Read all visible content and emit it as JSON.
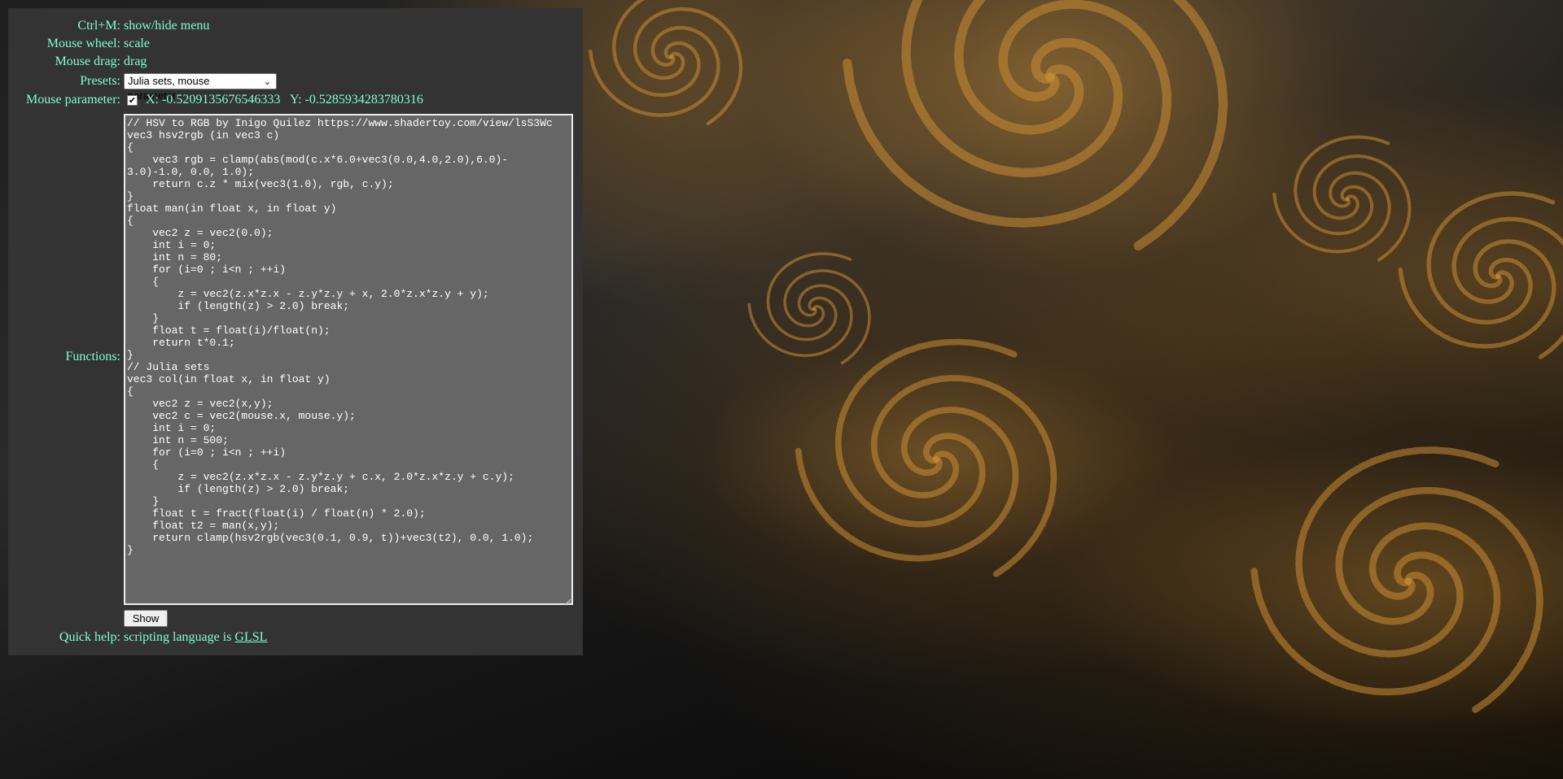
{
  "menu": {
    "rows": [
      {
        "label": "Ctrl+M:",
        "value": "show/hide menu"
      },
      {
        "label": "Mouse wheel:",
        "value": "scale"
      },
      {
        "label": "Mouse drag:",
        "value": "drag"
      }
    ],
    "presets": {
      "label": "Presets:",
      "selected": "Julia sets, mouse parameter"
    },
    "mouse_parameter": {
      "label": "Mouse parameter:",
      "checked": true,
      "x_text": "X: -0.5209135676546333",
      "y_text": "Y: -0.5285934283780316"
    },
    "functions": {
      "label": "Functions:",
      "code": "// HSV to RGB by Inigo Quilez https://www.shadertoy.com/view/lsS3Wc\nvec3 hsv2rgb (in vec3 c)\n{\n    vec3 rgb = clamp(abs(mod(c.x*6.0+vec3(0.0,4.0,2.0),6.0)-\n3.0)-1.0, 0.0, 1.0);\n    return c.z * mix(vec3(1.0), rgb, c.y);\n}\nfloat man(in float x, in float y)\n{\n    vec2 z = vec2(0.0);\n    int i = 0;\n    int n = 80;\n    for (i=0 ; i<n ; ++i)\n    {\n        z = vec2(z.x*z.x - z.y*z.y + x, 2.0*z.x*z.y + y);\n        if (length(z) > 2.0) break;\n    }\n    float t = float(i)/float(n);\n    return t*0.1;\n}\n// Julia sets\nvec3 col(in float x, in float y)\n{\n    vec2 z = vec2(x,y);\n    vec2 c = vec2(mouse.x, mouse.y);\n    int i = 0;\n    int n = 500;\n    for (i=0 ; i<n ; ++i)\n    {\n        z = vec2(z.x*z.x - z.y*z.y + c.x, 2.0*z.x*z.y + c.y);\n        if (length(z) > 2.0) break;\n    }\n    float t = fract(float(i) / float(n) * 2.0);\n    float t2 = man(x,y);\n    return clamp(hsv2rgb(vec3(0.1, 0.9, t))+vec3(t2), 0.0, 1.0);\n}"
    },
    "show_button": "Show",
    "quick_help": {
      "label": "Quick help:",
      "text": "scripting language is ",
      "link": "GLSL"
    }
  },
  "colors": {
    "panel_bg": "#333333",
    "label_text": "#7fffd4",
    "textarea_bg": "#666666",
    "fractal_gold": "#c98c33",
    "fractal_dark": "#1e1e1e"
  },
  "icons": {
    "checkbox": "check-icon",
    "select_arrow": "chevron-down-icon",
    "resize": "resize-grip-icon"
  }
}
